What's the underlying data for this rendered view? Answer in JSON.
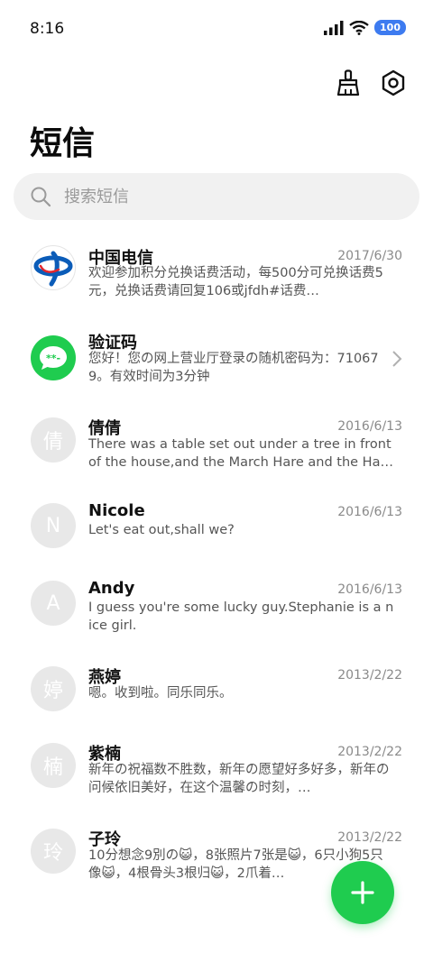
{
  "status": {
    "time": "8:16",
    "battery": "100"
  },
  "colors": {
    "accent": "#1fcc4f",
    "battery": "#3d7bf0",
    "ct_blue": "#0b5cb8"
  },
  "page": {
    "title": "短信"
  },
  "search": {
    "placeholder": "搜索短信"
  },
  "toolbar": {
    "clean_icon": "broom-icon",
    "settings_icon": "hex-gear-icon"
  },
  "messages": [
    {
      "sender": "中国电信",
      "date": "2017/6/30",
      "preview": "欢迎参加积分兑换话费活动，每500分可兑换话费5元，兑换话费请回复106或jfdh#话费…",
      "avatar_type": "ct-logo-icon",
      "avatar_text": ""
    },
    {
      "sender": "验证码",
      "date": "",
      "preview": "您好！您の网上营业厅登录の随机密码为：710679。有效时间为3分钟",
      "avatar_type": "verification-code-icon",
      "avatar_text": ""
    },
    {
      "sender": "倩倩",
      "date": "2016/6/13",
      "preview": "There was a table set out under a tree in front of the house,and the March Hare and the Hatter we…",
      "avatar_type": "letter",
      "avatar_text": "倩"
    },
    {
      "sender": "Nicole",
      "date": "2016/6/13",
      "preview": "Let's eat out,shall we?",
      "avatar_type": "letter",
      "avatar_text": "N"
    },
    {
      "sender": "Andy",
      "date": "2016/6/13",
      "preview": "I guess you're some lucky guy.Stephanie is a nice girl.",
      "avatar_type": "letter",
      "avatar_text": "A"
    },
    {
      "sender": "燕婷",
      "date": "2013/2/22",
      "preview": "嗯。收到啦。同乐同乐。",
      "avatar_type": "letter",
      "avatar_text": "婷"
    },
    {
      "sender": "紫楠",
      "date": "2013/2/22",
      "preview": "新年の祝福数不胜数，新年の愿望好多好多，新年の问候依旧美好，在这个温馨の时刻，…",
      "avatar_type": "letter",
      "avatar_text": "楠"
    },
    {
      "sender": "子玲",
      "date": "2013/2/22",
      "preview": "10分想念9別の😺，8张照片7张是😺，6只小狗5只像😺，4根骨头3根归😺，2爪着…",
      "avatar_type": "letter",
      "avatar_text": "玲"
    }
  ],
  "fab": {
    "icon": "plus-icon"
  }
}
